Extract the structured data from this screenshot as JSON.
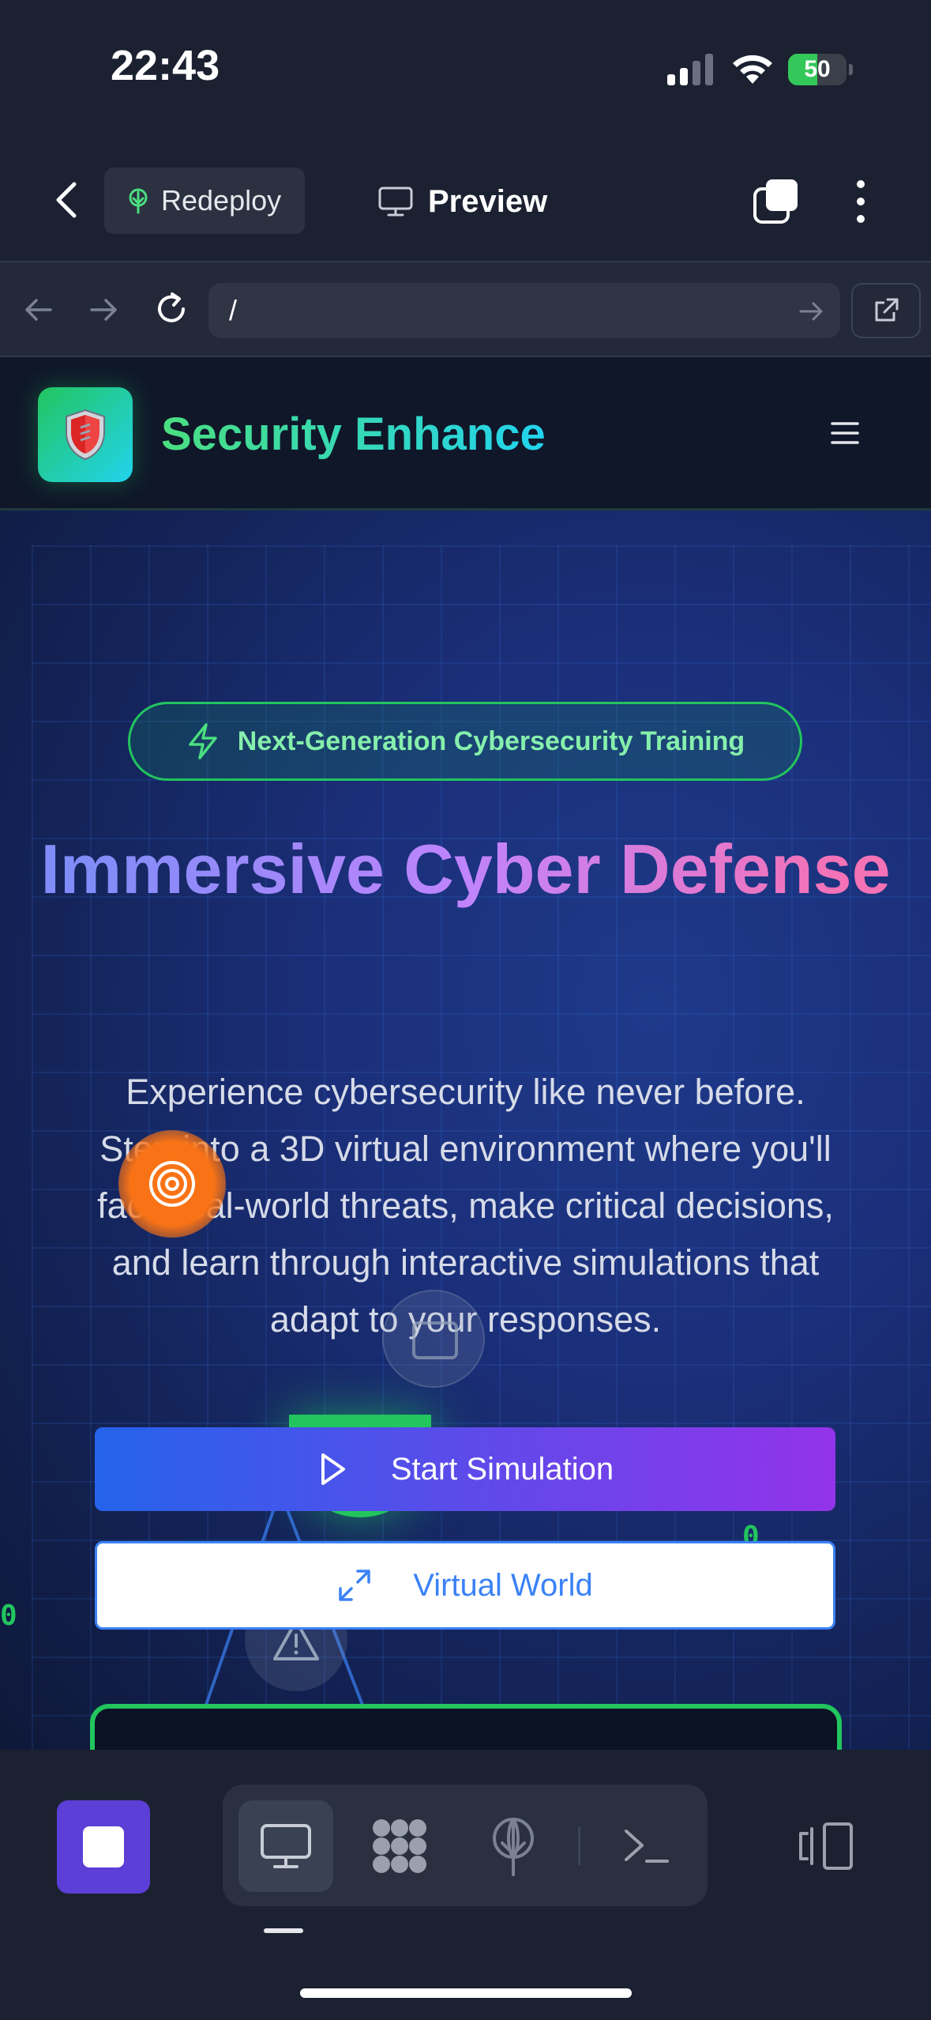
{
  "status_bar": {
    "time": "22:43",
    "battery_level": "50",
    "battery_fraction": 0.5
  },
  "app_bar": {
    "redeploy_label": "Redeploy",
    "preview_label": "Preview"
  },
  "url_bar": {
    "url": "/"
  },
  "site": {
    "title": "Security Enhance",
    "badge": "Next-Generation Cybersecurity Training",
    "hero_title": "Immersive Cyber Defense",
    "hero_description": "Experience cybersecurity like never before. Step into a 3D virtual environment where you'll face real-world threats, make critical decisions, and learn through interactive simulations that adapt to your responses.",
    "primary_button": "Start Simulation",
    "secondary_button": "Virtual World",
    "deco_digit": "0"
  },
  "colors": {
    "accent_purple": "#5b3fd6",
    "brand_green": "#22c55e",
    "brand_cyan": "#22d3ee",
    "link_blue": "#3b82f6"
  },
  "icons": {
    "back": "chevron-left-icon",
    "redeploy": "tree-icon",
    "preview": "monitor-icon",
    "tabs": "tabs-icon",
    "more": "more-vertical-icon",
    "logo": "shield-icon",
    "menu": "hamburger-icon",
    "badge": "lightning-icon",
    "start": "play-icon",
    "virtual": "expand-icon"
  }
}
